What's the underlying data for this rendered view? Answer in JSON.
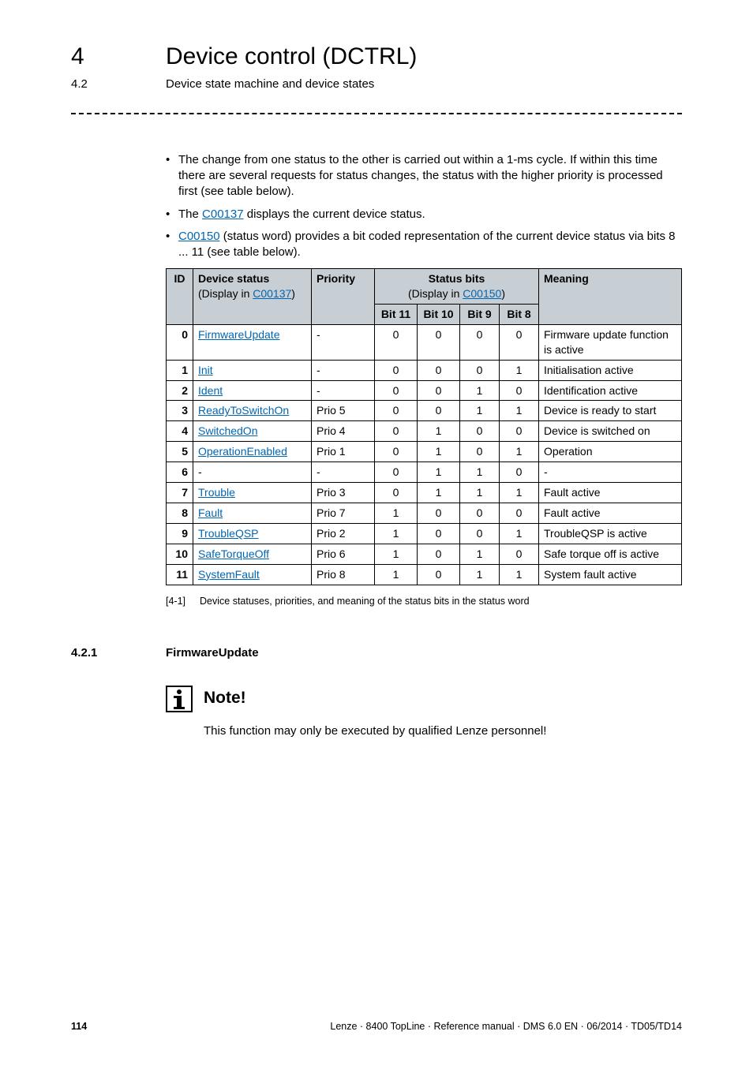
{
  "header": {
    "chapter_number": "4",
    "chapter_title": "Device control (DCTRL)",
    "section_number": "4.2",
    "section_title": "Device state machine and device states"
  },
  "bullets": [
    {
      "pre": "The change from one status to the other is carried out within a 1-ms cycle. If within this time there are several requests for status changes, the status with the higher priority is processed first (see table below)."
    },
    {
      "pre": "The ",
      "link": "C00137",
      "post": " displays the current device status."
    },
    {
      "link": "C00150",
      "post": " (status word) provides a bit coded representation of the current device status via bits 8 ... 11 (see table below)."
    }
  ],
  "table": {
    "headers": {
      "id": "ID",
      "device_status": "Device status",
      "display_in_1_pre": "(Display in ",
      "display_in_1_link": "C00137",
      "display_in_1_post": ")",
      "priority": "Priority",
      "status_bits": "Status bits",
      "display_in_2_pre": "(Display in ",
      "display_in_2_link": "C00150",
      "display_in_2_post": ")",
      "meaning": "Meaning",
      "bit11": "Bit 11",
      "bit10": "Bit 10",
      "bit9": "Bit 9",
      "bit8": "Bit 8"
    },
    "rows": [
      {
        "id": "0",
        "status": "FirmwareUpdate",
        "link": true,
        "priority": "-",
        "b11": "0",
        "b10": "0",
        "b9": "0",
        "b8": "0",
        "meaning": "Firmware update function is active"
      },
      {
        "id": "1",
        "status": "Init",
        "link": true,
        "priority": "-",
        "b11": "0",
        "b10": "0",
        "b9": "0",
        "b8": "1",
        "meaning": "Initialisation active"
      },
      {
        "id": "2",
        "status": "Ident",
        "link": true,
        "priority": "-",
        "b11": "0",
        "b10": "0",
        "b9": "1",
        "b8": "0",
        "meaning": "Identification active"
      },
      {
        "id": "3",
        "status": "ReadyToSwitchOn",
        "link": true,
        "priority": "Prio 5",
        "b11": "0",
        "b10": "0",
        "b9": "1",
        "b8": "1",
        "meaning": "Device is ready to start"
      },
      {
        "id": "4",
        "status": "SwitchedOn",
        "link": true,
        "priority": "Prio 4",
        "b11": "0",
        "b10": "1",
        "b9": "0",
        "b8": "0",
        "meaning": "Device is switched on"
      },
      {
        "id": "5",
        "status": "OperationEnabled",
        "link": true,
        "priority": "Prio 1",
        "b11": "0",
        "b10": "1",
        "b9": "0",
        "b8": "1",
        "meaning": "Operation"
      },
      {
        "id": "6",
        "status": "-",
        "link": false,
        "priority": "-",
        "b11": "0",
        "b10": "1",
        "b9": "1",
        "b8": "0",
        "meaning": "-"
      },
      {
        "id": "7",
        "status": "Trouble",
        "link": true,
        "priority": "Prio 3",
        "b11": "0",
        "b10": "1",
        "b9": "1",
        "b8": "1",
        "meaning": "Fault active"
      },
      {
        "id": "8",
        "status": "Fault",
        "link": true,
        "priority": "Prio 7",
        "b11": "1",
        "b10": "0",
        "b9": "0",
        "b8": "0",
        "meaning": "Fault active"
      },
      {
        "id": "9",
        "status": "TroubleQSP",
        "link": true,
        "priority": "Prio 2",
        "b11": "1",
        "b10": "0",
        "b9": "0",
        "b8": "1",
        "meaning": "TroubleQSP is active"
      },
      {
        "id": "10",
        "status": "SafeTorqueOff",
        "link": true,
        "priority": "Prio 6",
        "b11": "1",
        "b10": "0",
        "b9": "1",
        "b8": "0",
        "meaning": "Safe torque off is active"
      },
      {
        "id": "11",
        "status": "SystemFault",
        "link": true,
        "priority": "Prio 8",
        "b11": "1",
        "b10": "0",
        "b9": "1",
        "b8": "1",
        "meaning": "System fault active"
      }
    ]
  },
  "caption": {
    "label": "[4-1]",
    "text": "Device statuses, priorities, and meaning of the status bits in the status word"
  },
  "subsection": {
    "number": "4.2.1",
    "title": "FirmwareUpdate"
  },
  "note": {
    "label": "Note!",
    "text": "This function may only be executed by qualified Lenze personnel!"
  },
  "footer": {
    "page": "114",
    "meta": "Lenze · 8400 TopLine · Reference manual · DMS 6.0 EN · 06/2014 · TD05/TD14"
  }
}
